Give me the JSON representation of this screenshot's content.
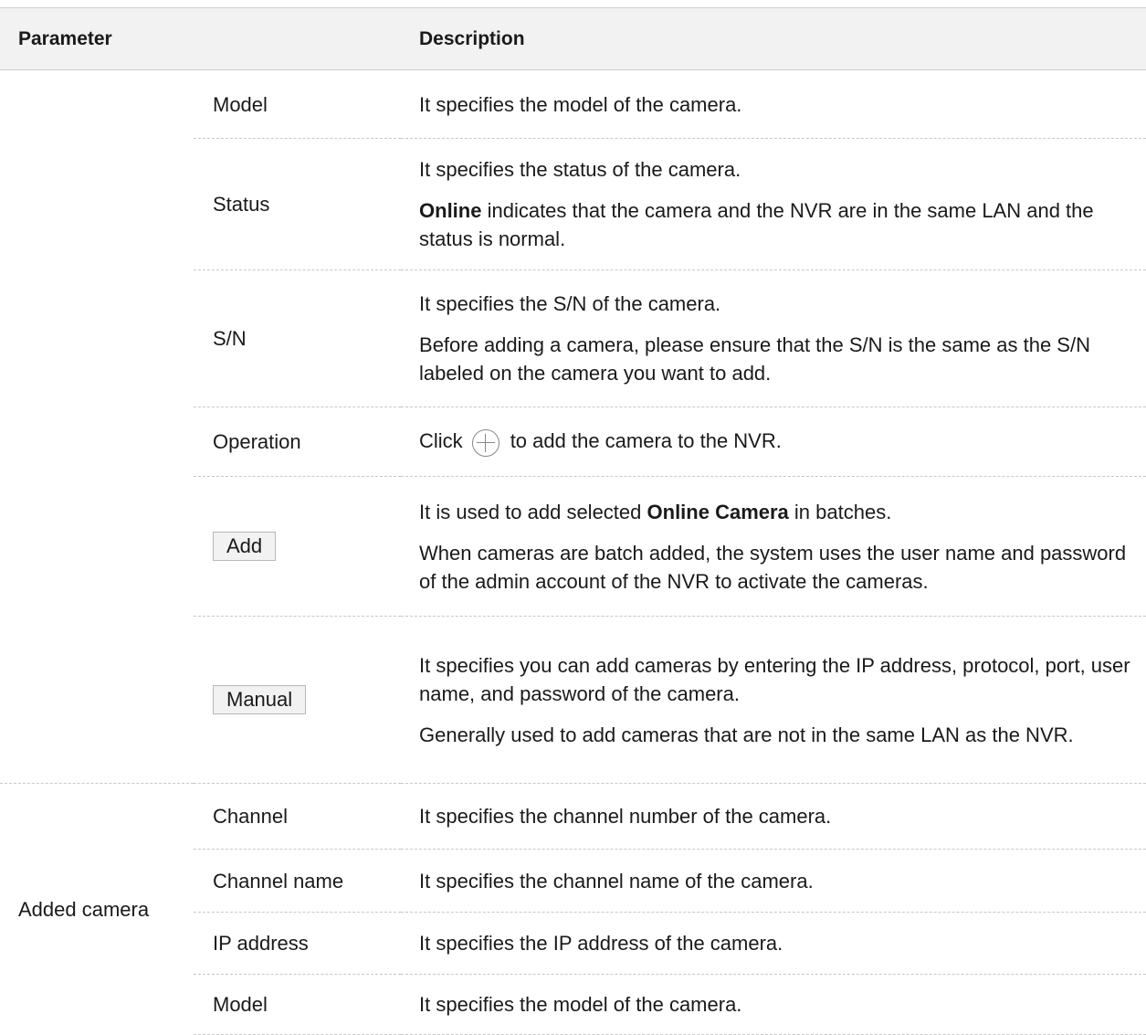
{
  "header": {
    "parameter": "Parameter",
    "description": "Description"
  },
  "online_rows": [
    {
      "name": "Model",
      "lines": [
        "It specifies the model of the camera."
      ]
    },
    {
      "name": "Status",
      "lines": [
        "It specifies the status of the camera."
      ],
      "bold_prefix": "Online",
      "bold_rest": " indicates that the camera and the NVR are in the same LAN and the status is normal."
    },
    {
      "name": "S/N",
      "lines": [
        "It specifies the S/N of the camera.",
        "Before adding a camera, please ensure that the S/N is the same as the S/N labeled on the camera you want to add."
      ]
    },
    {
      "name": "Operation",
      "click": "Click",
      "rest": "to add the camera to the NVR."
    },
    {
      "name": "Add",
      "pre": "It is used to add selected ",
      "bold": "Online Camera",
      "post": " in batches.",
      "line2": "When cameras are batch added, the system uses the user name and password of the admin account of the NVR to activate the cameras."
    },
    {
      "name": "Manual",
      "lines": [
        "It specifies you can add cameras by entering the IP address, protocol, port, user name, and password of the camera.",
        "Generally used to add cameras that are not in the same LAN as the NVR."
      ]
    }
  ],
  "added_group": "Added camera",
  "added_rows": [
    {
      "name": "Channel",
      "desc": "It specifies the channel number of the camera."
    },
    {
      "name": "Channel name",
      "desc": "It specifies the channel name of the camera."
    },
    {
      "name": "IP address",
      "desc": "It specifies the IP address of the camera."
    },
    {
      "name": "Model",
      "desc": "It specifies the model of the camera."
    }
  ],
  "icons": {
    "operation_icon": "add-circle-icon"
  }
}
